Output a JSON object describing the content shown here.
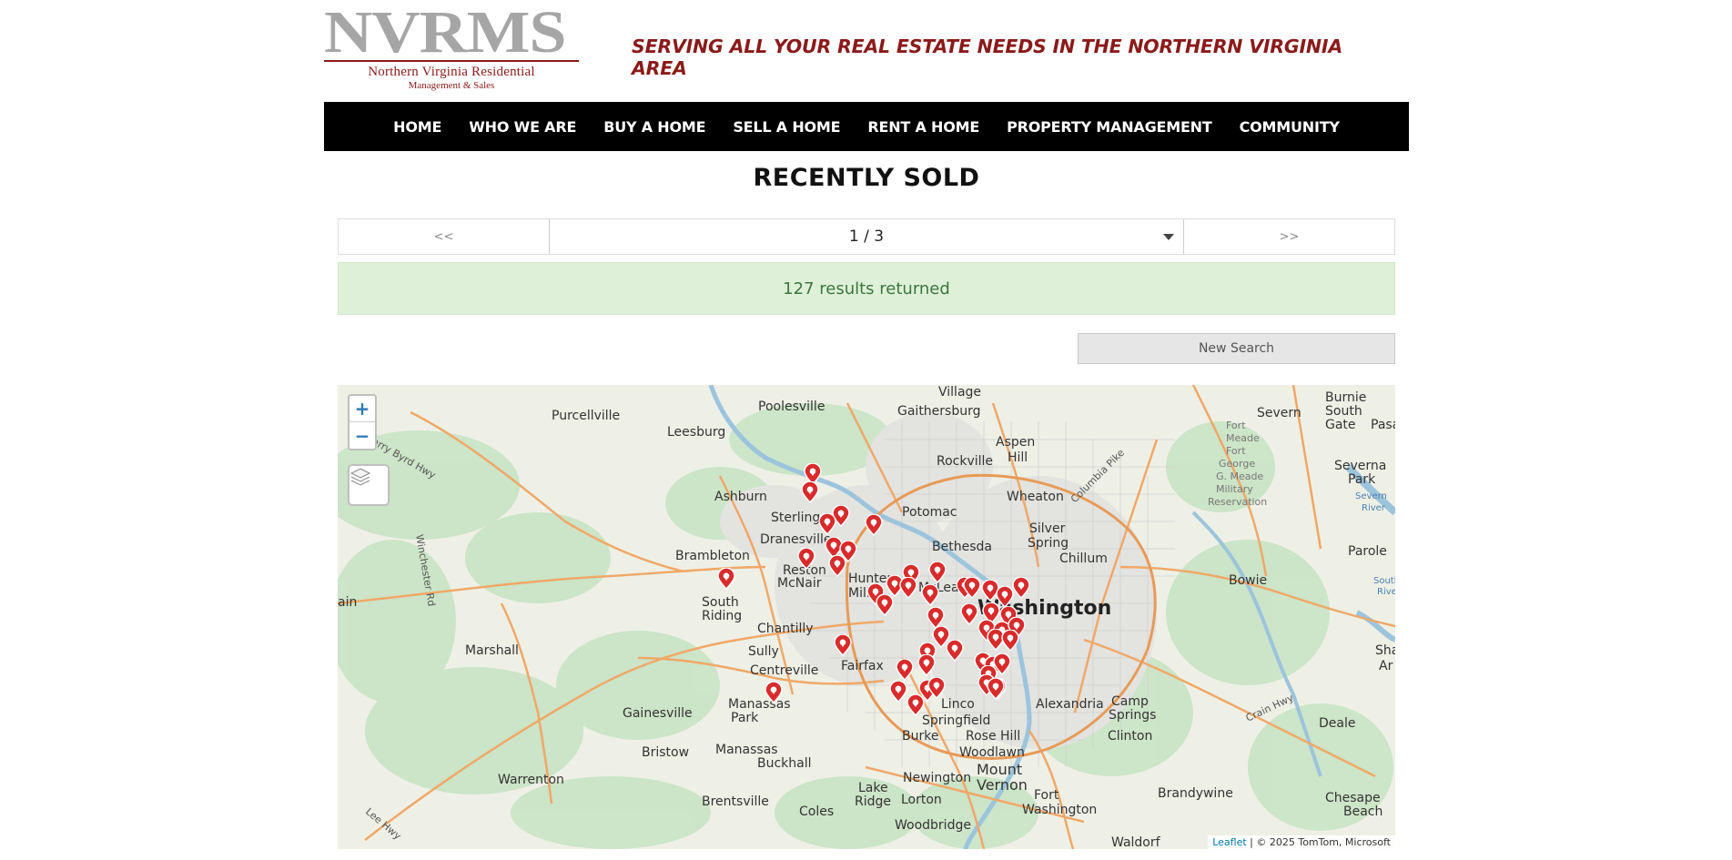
{
  "header": {
    "logo_mark": "NVRMS",
    "logo_line1": "Northern Virginia Residential",
    "logo_line2": "Management & Sales",
    "tagline": "SERVING ALL YOUR REAL ESTATE NEEDS IN THE NORTHERN VIRGINIA AREA"
  },
  "nav": {
    "items": [
      "HOME",
      "WHO WE ARE",
      "BUY A HOME",
      "SELL A HOME",
      "RENT A HOME",
      "PROPERTY MANAGEMENT",
      "COMMUNITY"
    ]
  },
  "page": {
    "title": "RECENTLY SOLD"
  },
  "pager": {
    "prev": "<<",
    "current": "1 / 3",
    "next": ">>"
  },
  "results": {
    "text": "127 results returned"
  },
  "buttons": {
    "new_search": "New Search"
  },
  "map": {
    "zoom_in": "+",
    "zoom_out": "−",
    "attribution_link": "Leaflet",
    "attribution_text": " | © 2025 TomTom, Microsoft",
    "place_labels": [
      "Village",
      "Poolesville",
      "Gaithersburg",
      "Severn",
      "Burnie",
      "South Gate",
      "Pasa",
      "Purcellville",
      "Leesburg",
      "Rockville",
      "Aspen Hill",
      "Fort Meade",
      "Fort George G. Meade Military Reservation",
      "Severna Park",
      "Ashburn",
      "Wheaton",
      "Sterling",
      "Potomac",
      "Silver Spring",
      "Dranesville",
      "Bethesda",
      "Chillum",
      "Brambleton",
      "Reston",
      "Hunter Mill",
      "McLean",
      "Washington",
      "Bowie",
      "Parole",
      "McNair",
      "South Riding",
      "Chantilly",
      "Sully",
      "Marshall",
      "Centreville",
      "Fairfax",
      "Alexandria",
      "Gainesville",
      "Manassas Park",
      "Lincolnia",
      "Camp Springs",
      "Springfield",
      "Burke",
      "Rose Hill",
      "Clinton",
      "Deale",
      "Bristow",
      "Manassas",
      "Buckhall",
      "Woodlawn",
      "Mount Vernon",
      "Warrenton",
      "Brentsville",
      "Coles",
      "Lake Ridge",
      "Lorton",
      "Fort Washington",
      "Brandywine",
      "Chesapeake",
      "Newington",
      "Woodbridge",
      "Waldorf",
      "South River",
      "Severn River",
      "Sha",
      "Ar",
      "ain",
      "Columbia Pike",
      "Harry Byrd Hwy",
      "Winchester Rd",
      "Crain Hwy",
      "Lee Hwy"
    ]
  },
  "colors": {
    "brand_red": "#8b1a1a",
    "nav_bg": "#000000",
    "alert_bg": "#dff0d8",
    "alert_text": "#3c763d",
    "pin": "#d92b2b"
  }
}
